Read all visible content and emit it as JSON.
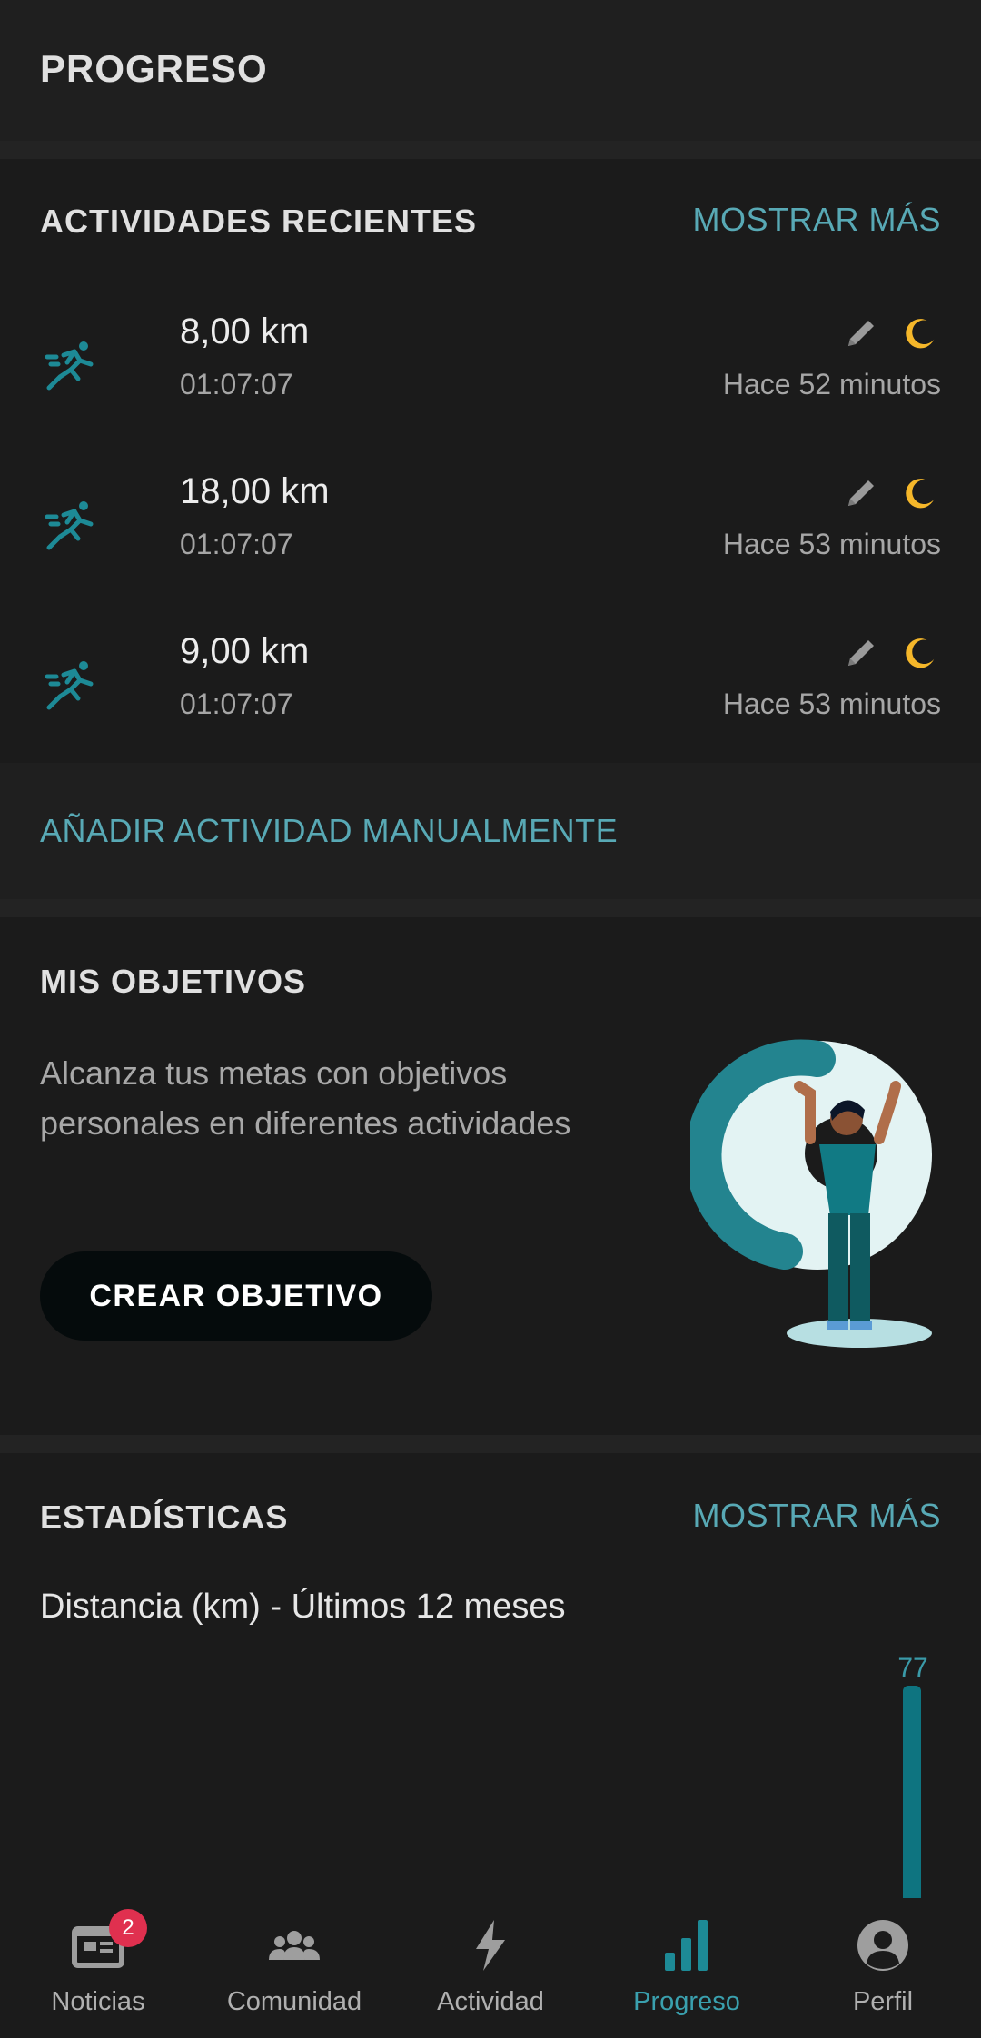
{
  "header": {
    "title": "PROGRESO"
  },
  "recent": {
    "title": "ACTIVIDADES RECIENTES",
    "show_more": "MOSTRAR MÁS",
    "items": [
      {
        "distance": "8,00 km",
        "duration": "01:07:07",
        "ago": "Hace 52 minutos"
      },
      {
        "distance": "18,00 km",
        "duration": "01:07:07",
        "ago": "Hace 53 minutos"
      },
      {
        "distance": "9,00 km",
        "duration": "01:07:07",
        "ago": "Hace 53 minutos"
      }
    ],
    "add_manual": "AÑADIR ACTIVIDAD MANUALMENTE"
  },
  "goals": {
    "title": "MIS OBJETIVOS",
    "description": "Alcanza tus metas con objetivos personales en diferentes actividades",
    "create_button": "CREAR OBJETIVO"
  },
  "stats": {
    "title": "ESTADÍSTICAS",
    "show_more": "MOSTRAR MÁS",
    "subtitle": "Distancia (km) - Últimos 12 meses"
  },
  "chart_data": {
    "type": "bar",
    "values": [
      77
    ],
    "data_labels": [
      "77"
    ],
    "color": "#0e7480"
  },
  "nav": {
    "items": [
      {
        "label": "Noticias",
        "icon": "news-icon",
        "badge": "2"
      },
      {
        "label": "Comunidad",
        "icon": "community-icon"
      },
      {
        "label": "Actividad",
        "icon": "lightning-icon"
      },
      {
        "label": "Progreso",
        "icon": "bar-chart-icon",
        "active": true
      },
      {
        "label": "Perfil",
        "icon": "profile-icon"
      }
    ]
  },
  "colors": {
    "accent": "#58a9b5",
    "teal_icon": "#1d8a96",
    "moon": "#f5b72a",
    "badge": "#e0304f",
    "background": "#1c1c1c"
  }
}
